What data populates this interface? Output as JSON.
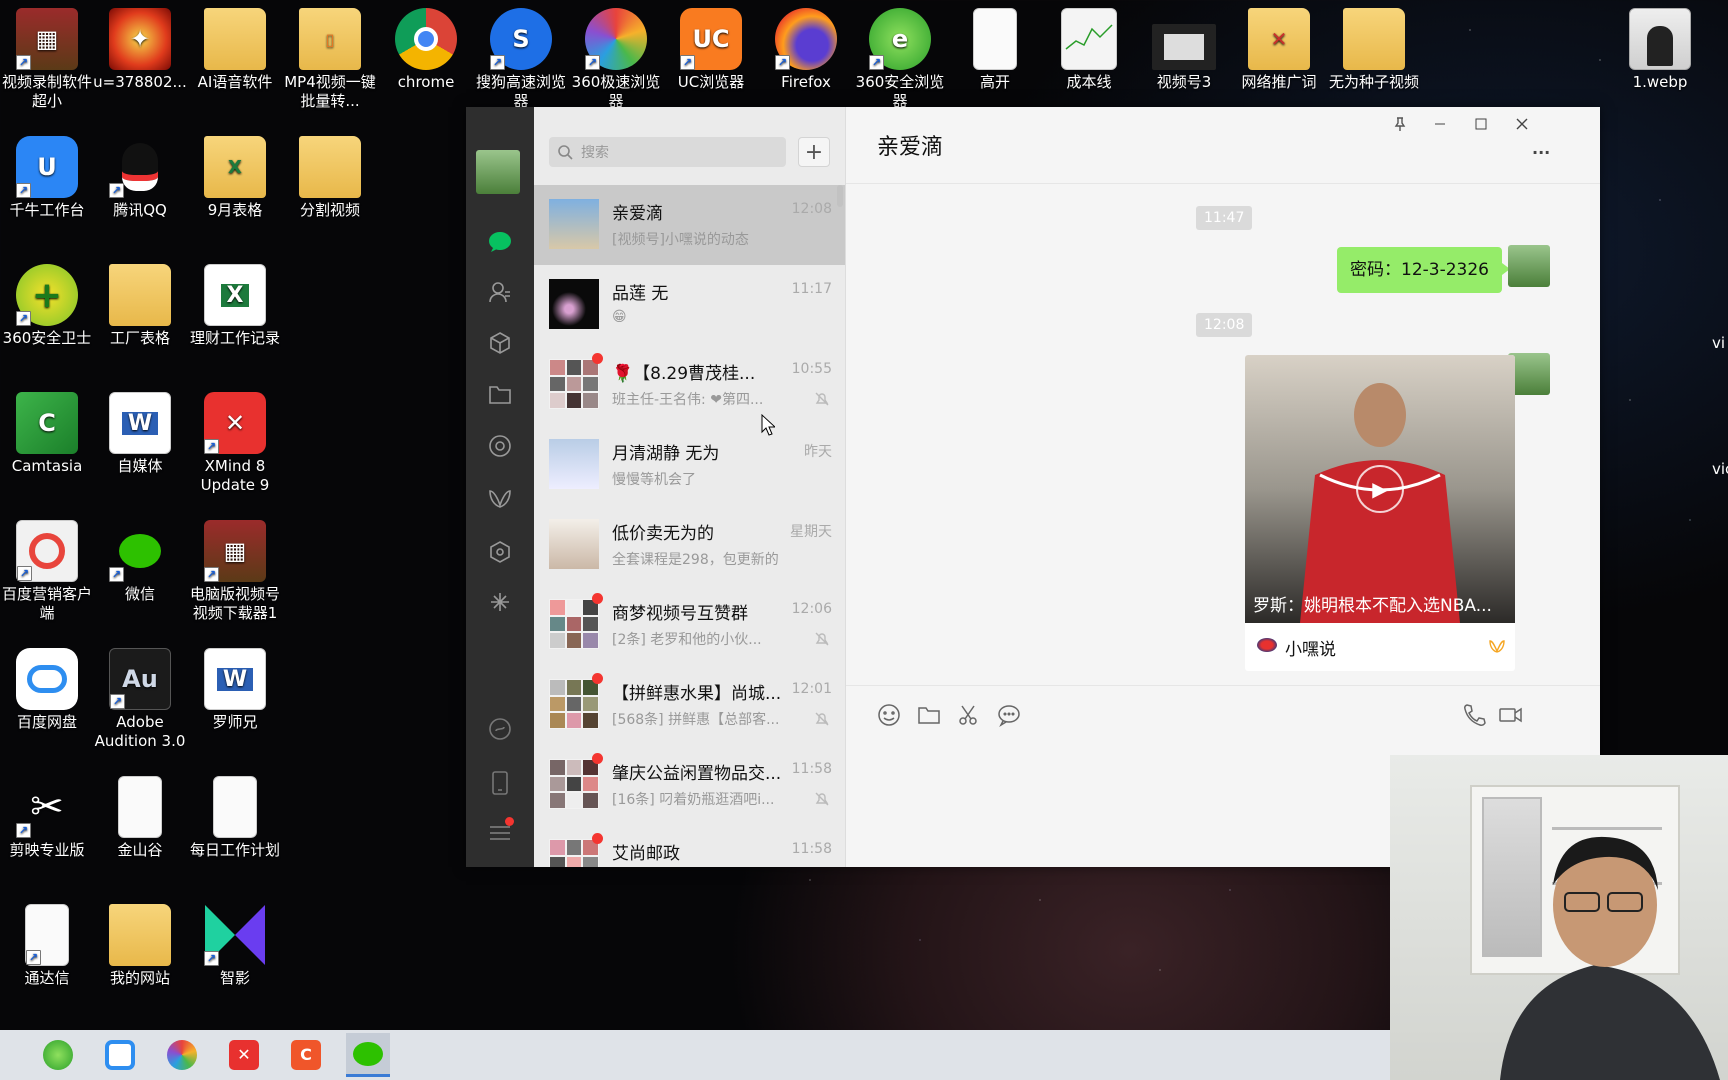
{
  "desktop": {
    "icons": [
      {
        "label": "视频录制软件 超小"
      },
      {
        "label": "u=378802..."
      },
      {
        "label": "AI语音软件"
      },
      {
        "label": "MP4视频一键批量转..."
      },
      {
        "label": "chrome"
      },
      {
        "label": "搜狗高速浏览器"
      },
      {
        "label": "360极速浏览器"
      },
      {
        "label": "UC浏览器"
      },
      {
        "label": "Firefox"
      },
      {
        "label": "360安全浏览器"
      },
      {
        "label": "高开"
      },
      {
        "label": "成本线"
      },
      {
        "label": "视频号3"
      },
      {
        "label": "网络推广词"
      },
      {
        "label": "无为种子视频"
      },
      {
        "label": "1.webp"
      },
      {
        "label": "千牛工作台"
      },
      {
        "label": "腾讯QQ"
      },
      {
        "label": "9月表格"
      },
      {
        "label": "分割视频"
      },
      {
        "label": "360安全卫士"
      },
      {
        "label": "工厂表格"
      },
      {
        "label": "理财工作记录"
      },
      {
        "label": "Camtasia"
      },
      {
        "label": "自媒体"
      },
      {
        "label": "XMind 8 Update 9"
      },
      {
        "label": "百度营销客户端"
      },
      {
        "label": "微信"
      },
      {
        "label": "电脑版视频号视频下载器1"
      },
      {
        "label": "百度网盘"
      },
      {
        "label": "Adobe Audition 3.0"
      },
      {
        "label": "罗师兄"
      },
      {
        "label": "剪映专业版"
      },
      {
        "label": "金山谷"
      },
      {
        "label": "每日工作计划"
      },
      {
        "label": "通达信"
      },
      {
        "label": "我的网站"
      },
      {
        "label": "智影"
      }
    ],
    "edge_labels": [
      "vi",
      "vic"
    ]
  },
  "wechat": {
    "search_placeholder": "搜索",
    "add_label": "+",
    "chats": [
      {
        "name": "亲爱滴",
        "time": "12:08",
        "preview": "[视频号]小嘿说的动态"
      },
      {
        "name": "品莲  无",
        "time": "11:17",
        "preview": "😁"
      },
      {
        "name": "🌹【8.29曹茂桂...",
        "time": "10:55",
        "preview": "班主任-王名伟: ❤第四..."
      },
      {
        "name": "月清湖静 无为",
        "time": "昨天",
        "preview": "慢慢等机会了"
      },
      {
        "name": "低价卖无为的",
        "time": "星期天",
        "preview": "全套课程是298，包更新的"
      },
      {
        "name": "商梦视频号互赞群",
        "time": "12:06",
        "preview": "[2条] 老罗和他的小伙..."
      },
      {
        "name": "【拼鲜惠水果】尚城...",
        "time": "12:01",
        "preview": "[568条] 拼鲜惠【总部客..."
      },
      {
        "name": "肇庆公益闲置物品交...",
        "time": "11:58",
        "preview": "[16条] 叼着奶瓶逛酒吧i..."
      },
      {
        "name": "艾尚邮政",
        "time": "11:58",
        "preview": ""
      }
    ],
    "conversation": {
      "title": "亲爱滴",
      "more": "···",
      "time_sep_1": "11:47",
      "message_text": "密码：12-3-2326",
      "time_sep_2": "12:08",
      "video_caption": "罗斯：姚明根本不配入选NBA...",
      "video_source": "小嘿说"
    }
  }
}
